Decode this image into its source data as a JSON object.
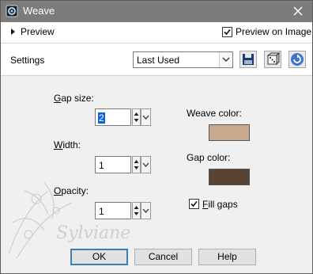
{
  "window": {
    "title": "Weave",
    "icons": {
      "app": "weave-app-icon",
      "close": "close-icon"
    }
  },
  "preview": {
    "toggle_label": "Preview",
    "preview_on_image_label": "Preview on Image",
    "preview_on_image_checked": true
  },
  "settings": {
    "label": "Settings",
    "preset_value": "Last Used",
    "icons": [
      "save-preset-icon",
      "randomize-dice-icon",
      "reset-icon"
    ]
  },
  "fields": {
    "gap_size": {
      "label_accel": "G",
      "label_rest": "ap size:",
      "value": "2"
    },
    "width": {
      "label_accel": "W",
      "label_rest": "idth:",
      "value": "1"
    },
    "opacity": {
      "label_accel": "O",
      "label_rest": "pacity:",
      "value": "1"
    }
  },
  "colors": {
    "weave_label": "Weave color:",
    "weave_color": "#c8a98e",
    "gap_label": "Gap color:",
    "gap_color": "#5a4330"
  },
  "fill_gaps": {
    "label_accel": "F",
    "label_rest": "ill gaps",
    "checked": true
  },
  "buttons": {
    "ok": "OK",
    "cancel": "Cancel",
    "help": "Help"
  },
  "watermark": {
    "text": "Sylviane"
  }
}
